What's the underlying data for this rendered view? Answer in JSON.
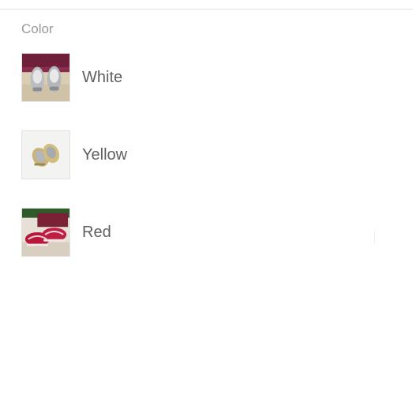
{
  "section": {
    "label": "Color"
  },
  "options": [
    {
      "label": "White",
      "image": "white-sneakers-photo"
    },
    {
      "label": "Yellow",
      "image": "yellow-sneakers-photo"
    },
    {
      "label": "Red",
      "image": "red-sneakers-photo"
    }
  ],
  "colors": {
    "label_text": "#5f5f5f",
    "section_label": "#9a9a9a",
    "divider": "#e1e1e1"
  }
}
